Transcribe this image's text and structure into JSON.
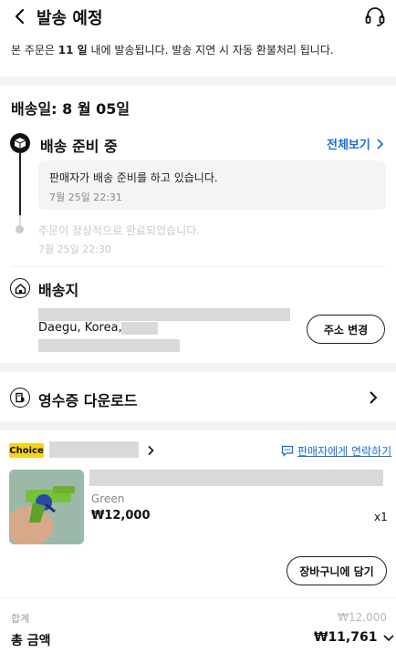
{
  "header": {
    "title": "발송 예정",
    "back_icon": "chevron-left-icon",
    "support_icon": "headset-icon"
  },
  "notice": {
    "prefix": "본 주문은 ",
    "days": "11 일",
    "suffix": " 내에 발송됩니다. 발송 지연 시 자동 환불처리 됩니다."
  },
  "shipping": {
    "date_label": "배송일: 8 월 05일",
    "current_step": "배송 준비 중",
    "view_all": "전체보기",
    "current_message": "판매자가 배송 준비를 하고 있습니다.",
    "current_time": "7월 25일 22:31",
    "prev_message": "주문이 정상적으로 완료되었습니다.",
    "prev_time": "7월 25일 22:30"
  },
  "address": {
    "title": "배송지",
    "city_line": "Daegu, Korea,",
    "change_button": "주소 변경"
  },
  "receipt": {
    "title": "영수증 다운로드"
  },
  "order_item": {
    "badge": "Choice",
    "contact_seller": "판매자에게 연락하기",
    "variant": "Green",
    "price": "₩12,000",
    "quantity": "x1",
    "add_to_cart": "장바구니에 담기"
  },
  "summary": {
    "subtotal_label": "합계",
    "subtotal_value": "₩12,000",
    "total_label": "총 금액",
    "total_value": "₩11,761"
  },
  "colors": {
    "accent": "#1a6fd8",
    "badge": "#f6d21b",
    "divider": "#f3f3f3"
  }
}
